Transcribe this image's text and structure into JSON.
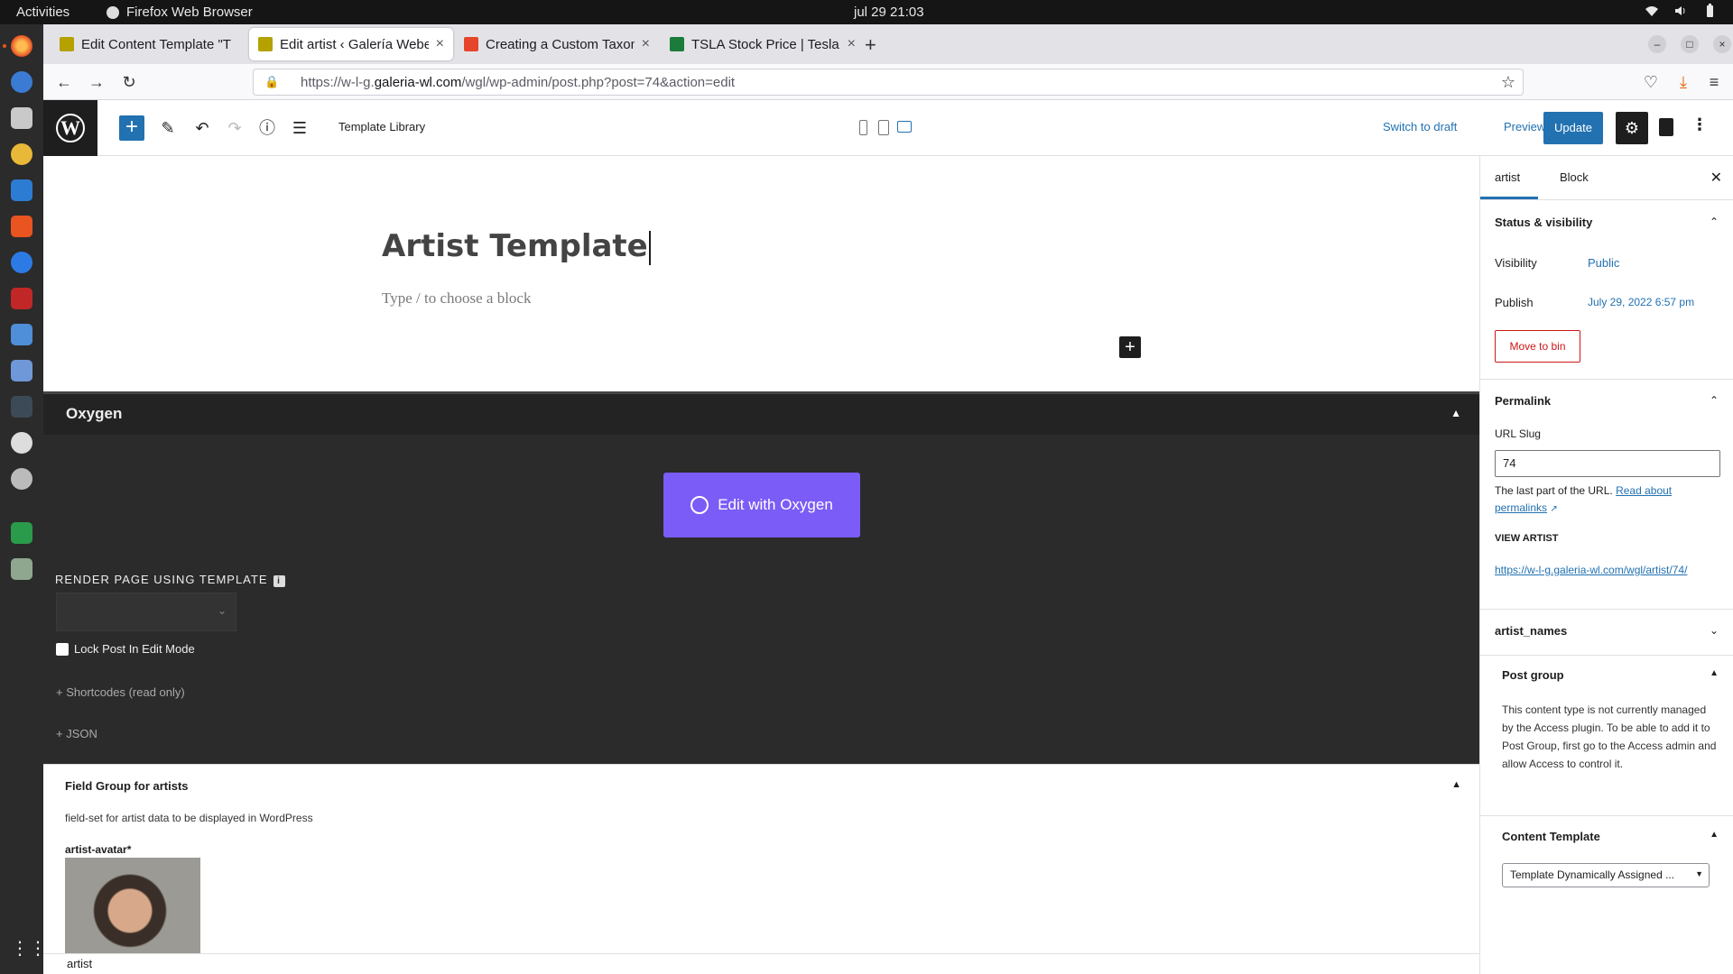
{
  "os": {
    "activities": "Activities",
    "app_name": "Firefox Web Browser",
    "clock": "jul 29  21:03"
  },
  "browser": {
    "tabs": [
      {
        "label": "Edit Content Template \"T",
        "active": false,
        "color": "#b5a100"
      },
      {
        "label": "Edit artist ‹ Galería Webe",
        "active": true,
        "color": "#b5a100"
      },
      {
        "label": "Creating a Custom Taxon",
        "active": false,
        "color": "#e5462b"
      },
      {
        "label": "TSLA Stock Price | Tesla I",
        "active": false,
        "color": "#1b7b3a"
      }
    ],
    "url_prefix": "https://w-l-g.",
    "url_domain": "galeria-wl.com",
    "url_suffix": "/wgl/wp-admin/post.php?post=74&action=edit"
  },
  "wp_header": {
    "logo": "W",
    "template_library": "Template Library",
    "switch_to_draft": "Switch to draft",
    "preview": "Preview",
    "update": "Update"
  },
  "editor": {
    "title": "Artist Template",
    "placeholder": "Type / to choose a block"
  },
  "oxygen": {
    "title": "Oxygen",
    "edit_button": "Edit with Oxygen",
    "render_label": "RENDER PAGE USING TEMPLATE",
    "lock_label": "Lock Post In Edit Mode",
    "shortcodes": "+ Shortcodes (read only)",
    "json": "+ JSON"
  },
  "field_group": {
    "title": "Field Group for artists",
    "description": "field-set for artist data to be displayed in WordPress",
    "avatar_label": "artist-avatar*"
  },
  "footer": {
    "breadcrumb": "artist"
  },
  "sidebar": {
    "tab_artist": "artist",
    "tab_block": "Block",
    "status_title": "Status & visibility",
    "visibility_label": "Visibility",
    "visibility_value": "Public",
    "publish_label": "Publish",
    "publish_value": "July 29, 2022 6:57 pm",
    "move_to_bin": "Move to bin",
    "permalink_title": "Permalink",
    "url_slug_label": "URL Slug",
    "url_slug_value": "74",
    "slug_help": "The last part of the URL.",
    "slug_help_link": "Read about permalinks",
    "view_artist_label": "VIEW ARTIST",
    "view_artist_link": "https://w-l-g.galeria-wl.com/wgl/artist/74/",
    "artist_names": "artist_names",
    "post_group_title": "Post group",
    "post_group_desc": "This content type is not currently managed by the Access plugin. To be able to add it to Post Group, first go to the Access admin and allow Access to control it.",
    "content_template_title": "Content Template",
    "content_template_value": "Template Dynamically Assigned ..."
  }
}
